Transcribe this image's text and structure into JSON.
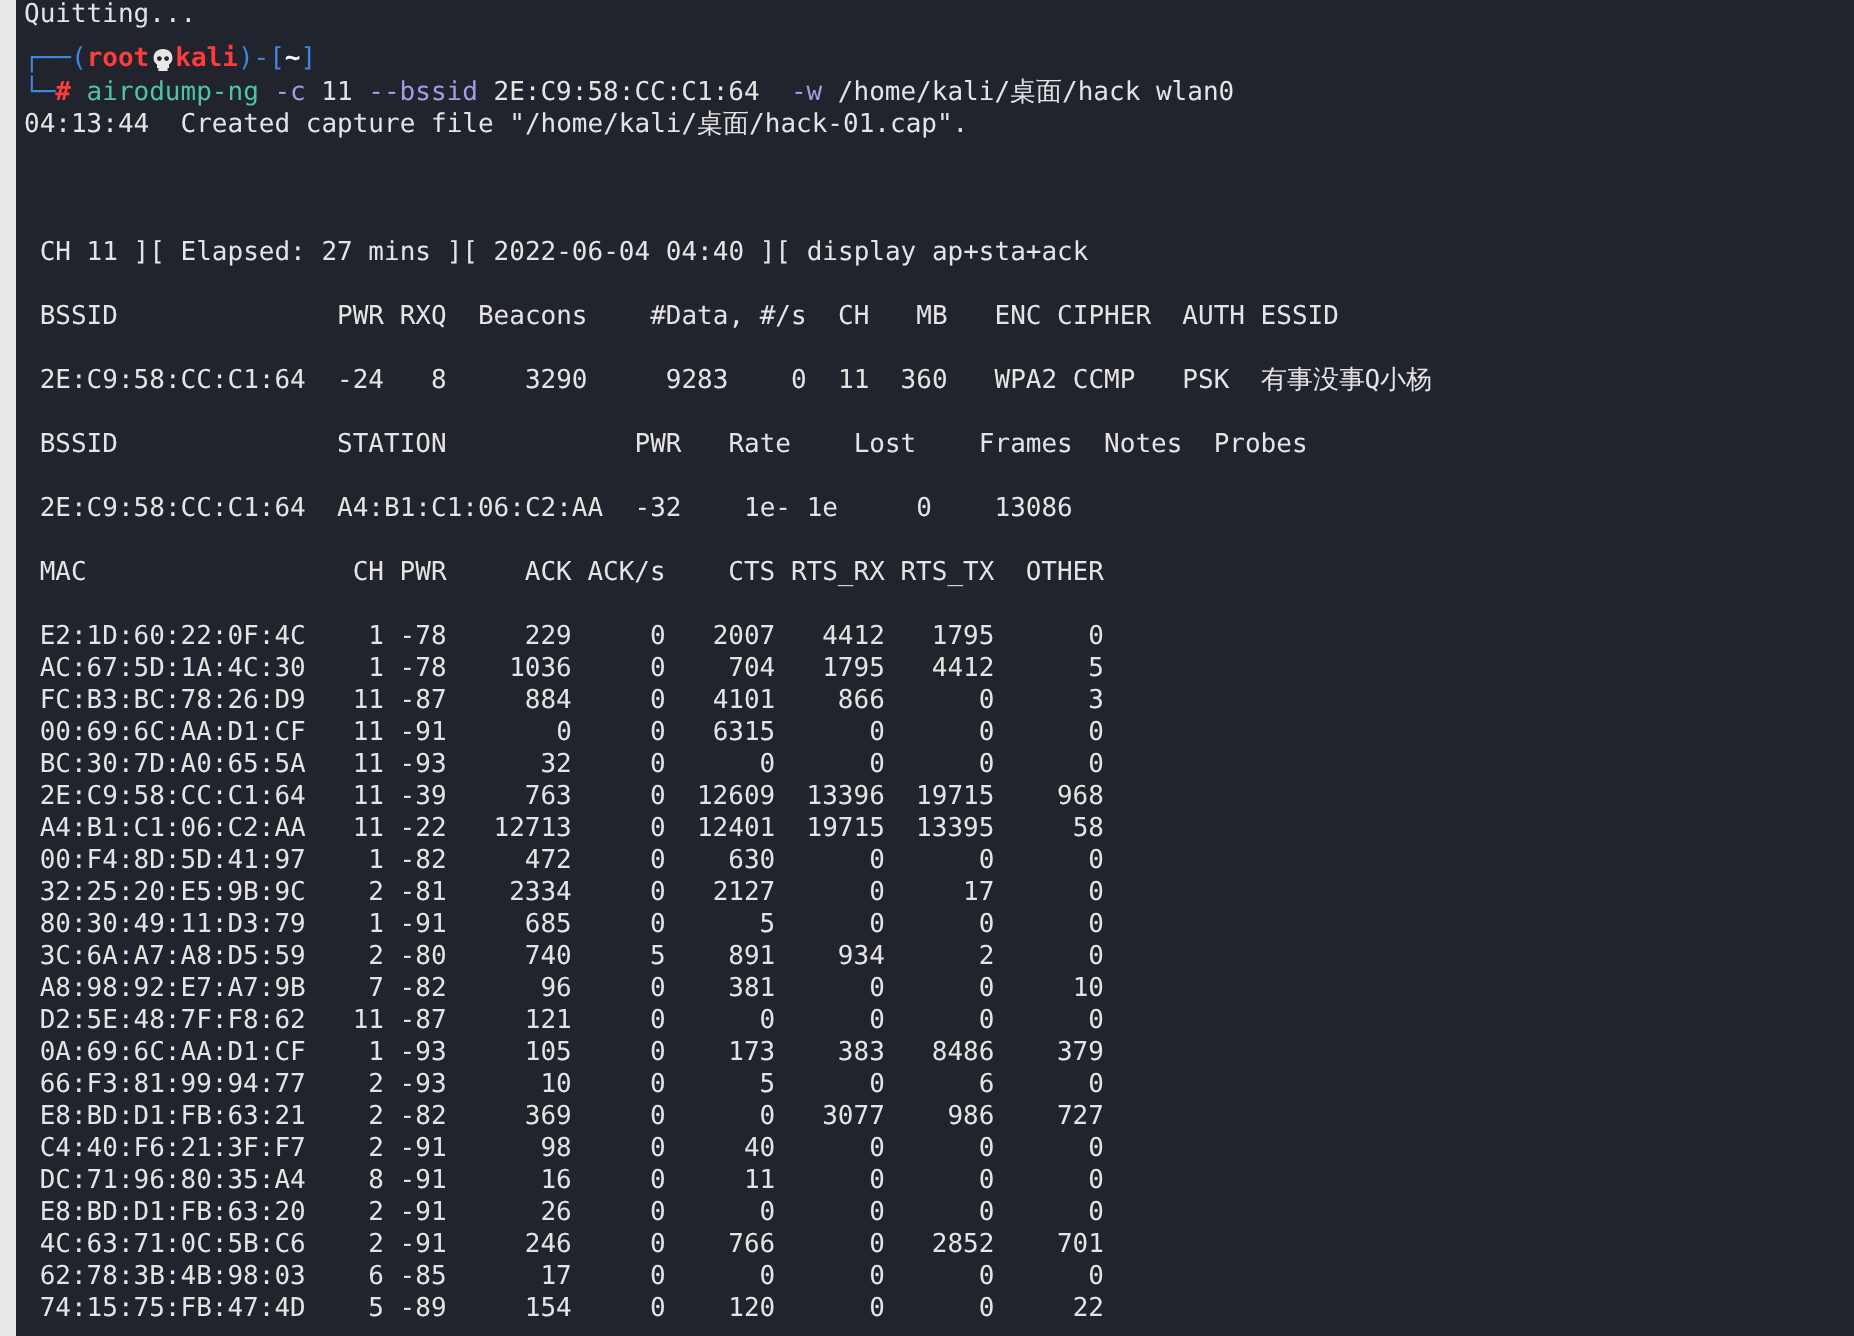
{
  "terminal": {
    "previous_output": "Quitting...",
    "prompt": {
      "open": "┌──(",
      "user": "root",
      "host": "kali",
      "mid": ")-[",
      "dir": "~",
      "close": "]",
      "corner": "└─",
      "symbol": "#"
    },
    "command": [
      {
        "kind": "program",
        "text": "airodump-ng"
      },
      {
        "kind": "option",
        "text": "-c"
      },
      {
        "kind": "arg",
        "text": "11"
      },
      {
        "kind": "option",
        "text": "--bssid"
      },
      {
        "kind": "arg",
        "text": "2E:C9:58:CC:C1:64 "
      },
      {
        "kind": "option",
        "text": "-w"
      },
      {
        "kind": "arg",
        "text": "/home/kali/桌面/hack"
      },
      {
        "kind": "arg",
        "text": "wlan0"
      }
    ],
    "output": "04:13:44  Created capture file \"/home/kali/桌面/hack-01.cap\".",
    "status": " CH 11 ][ Elapsed: 27 mins ][ 2022-06-04 04:40 ][ display ap+sta+ack",
    "ap_table": {
      "header": " BSSID              PWR RXQ  Beacons    #Data, #/s  CH   MB   ENC CIPHER  AUTH ESSID",
      "rows": [
        " 2E:C9:58:CC:C1:64  -24   8     3290     9283    0  11  360   WPA2 CCMP   PSK  有事没事Q小杨"
      ]
    },
    "station_table": {
      "header": " BSSID              STATION            PWR   Rate    Lost    Frames  Notes  Probes",
      "rows": [
        " 2E:C9:58:CC:C1:64  A4:B1:C1:06:C2:AA  -32    1e- 1e     0    13086"
      ]
    },
    "ack_table": {
      "columns": [
        "MAC",
        "CH",
        "PWR",
        "ACK",
        "ACK/s",
        "CTS",
        "RTS_RX",
        "RTS_TX",
        "OTHER"
      ],
      "rows": [
        [
          "E2:1D:60:22:0F:4C",
          "1",
          "-78",
          "229",
          "0",
          "2007",
          "4412",
          "1795",
          "0"
        ],
        [
          "AC:67:5D:1A:4C:30",
          "1",
          "-78",
          "1036",
          "0",
          "704",
          "1795",
          "4412",
          "5"
        ],
        [
          "FC:B3:BC:78:26:D9",
          "11",
          "-87",
          "884",
          "0",
          "4101",
          "866",
          "0",
          "3"
        ],
        [
          "00:69:6C:AA:D1:CF",
          "11",
          "-91",
          "0",
          "0",
          "6315",
          "0",
          "0",
          "0"
        ],
        [
          "BC:30:7D:A0:65:5A",
          "11",
          "-93",
          "32",
          "0",
          "0",
          "0",
          "0",
          "0"
        ],
        [
          "2E:C9:58:CC:C1:64",
          "11",
          "-39",
          "763",
          "0",
          "12609",
          "13396",
          "19715",
          "968"
        ],
        [
          "A4:B1:C1:06:C2:AA",
          "11",
          "-22",
          "12713",
          "0",
          "12401",
          "19715",
          "13395",
          "58"
        ],
        [
          "00:F4:8D:5D:41:97",
          "1",
          "-82",
          "472",
          "0",
          "630",
          "0",
          "0",
          "0"
        ],
        [
          "32:25:20:E5:9B:9C",
          "2",
          "-81",
          "2334",
          "0",
          "2127",
          "0",
          "17",
          "0"
        ],
        [
          "80:30:49:11:D3:79",
          "1",
          "-91",
          "685",
          "0",
          "5",
          "0",
          "0",
          "0"
        ],
        [
          "3C:6A:A7:A8:D5:59",
          "2",
          "-80",
          "740",
          "5",
          "891",
          "934",
          "2",
          "0"
        ],
        [
          "A8:98:92:E7:A7:9B",
          "7",
          "-82",
          "96",
          "0",
          "381",
          "0",
          "0",
          "10"
        ],
        [
          "D2:5E:48:7F:F8:62",
          "11",
          "-87",
          "121",
          "0",
          "0",
          "0",
          "0",
          "0"
        ],
        [
          "0A:69:6C:AA:D1:CF",
          "1",
          "-93",
          "105",
          "0",
          "173",
          "383",
          "8486",
          "379"
        ],
        [
          "66:F3:81:99:94:77",
          "2",
          "-93",
          "10",
          "0",
          "5",
          "0",
          "6",
          "0"
        ],
        [
          "E8:BD:D1:FB:63:21",
          "2",
          "-82",
          "369",
          "0",
          "0",
          "3077",
          "986",
          "727"
        ],
        [
          "C4:40:F6:21:3F:F7",
          "2",
          "-91",
          "98",
          "0",
          "40",
          "0",
          "0",
          "0"
        ],
        [
          "DC:71:96:80:35:A4",
          "8",
          "-91",
          "16",
          "0",
          "11",
          "0",
          "0",
          "0"
        ],
        [
          "E8:BD:D1:FB:63:20",
          "2",
          "-91",
          "26",
          "0",
          "0",
          "0",
          "0",
          "0"
        ],
        [
          "4C:63:71:0C:5B:C6",
          "2",
          "-91",
          "246",
          "0",
          "766",
          "0",
          "2852",
          "701"
        ],
        [
          "62:78:3B:4B:98:03",
          "6",
          "-85",
          "17",
          "0",
          "0",
          "0",
          "0",
          "0"
        ],
        [
          "74:15:75:FB:47:4D",
          "5",
          "-89",
          "154",
          "0",
          "120",
          "0",
          "0",
          "22"
        ]
      ]
    }
  }
}
